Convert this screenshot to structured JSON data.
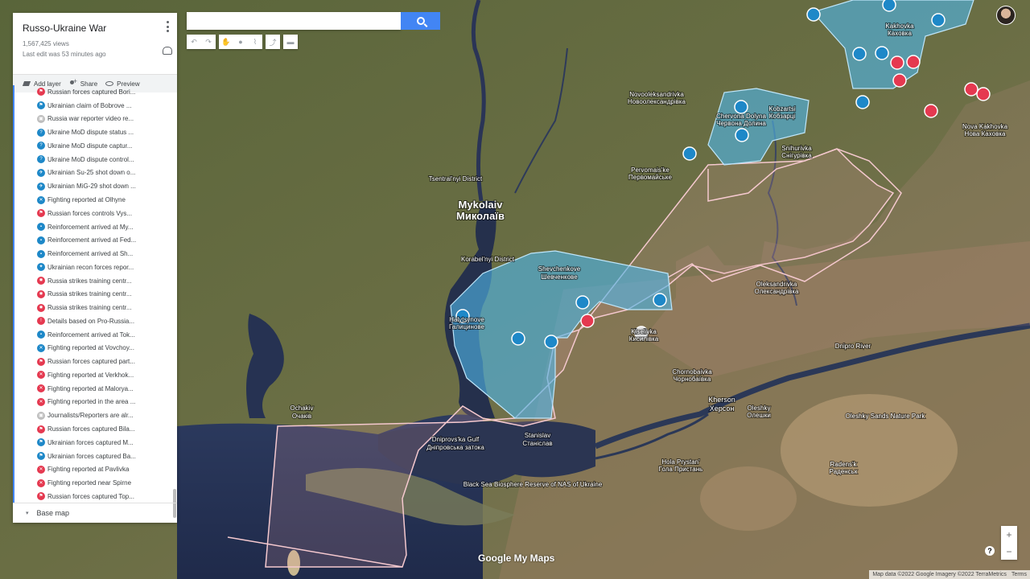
{
  "panel": {
    "title": "Russo-Ukraine War",
    "views": "1,567,425 views",
    "last_edit": "Last edit was 53 minutes ago",
    "actions": {
      "add_layer": "Add layer",
      "share": "Share",
      "preview": "Preview"
    },
    "base_map": "Base map",
    "items": [
      {
        "label": "Russian forces captured Bori...",
        "color": "#e53950",
        "icon": "flag"
      },
      {
        "label": "Ukrainian claim of Bobrove ...",
        "color": "#1e88c8",
        "icon": "flag"
      },
      {
        "label": "Russia war reporter video re...",
        "color": "#bdbdbd",
        "icon": "camera"
      },
      {
        "label": "Ukraine MoD dispute status ...",
        "color": "#1e88c8",
        "icon": "question"
      },
      {
        "label": "Ukraine MoD dispute captur...",
        "color": "#1e88c8",
        "icon": "question"
      },
      {
        "label": "Ukraine MoD dispute control...",
        "color": "#1e88c8",
        "icon": "question"
      },
      {
        "label": "Ukrainian Su-25 shot down o...",
        "color": "#1e88c8",
        "icon": "plane"
      },
      {
        "label": "Ukrainian MiG-29 shot down ...",
        "color": "#1e88c8",
        "icon": "plane"
      },
      {
        "label": "Fighting reported at Olhyne",
        "color": "#1e88c8",
        "icon": "swords"
      },
      {
        "label": "Russian forces controls Vys...",
        "color": "#e53950",
        "icon": "flag"
      },
      {
        "label": "Reinforcement arrived at My...",
        "color": "#1e88c8",
        "icon": "truck"
      },
      {
        "label": "Reinforcement arrived at Fed...",
        "color": "#1e88c8",
        "icon": "truck"
      },
      {
        "label": "Reinforcement arrived at Sh...",
        "color": "#1e88c8",
        "icon": "truck"
      },
      {
        "label": "Ukrainian recon forces repor...",
        "color": "#1e88c8",
        "icon": "walker"
      },
      {
        "label": "Russia strikes training centr...",
        "color": "#e53950",
        "icon": "burst"
      },
      {
        "label": "Russia strikes training centr...",
        "color": "#e53950",
        "icon": "burst"
      },
      {
        "label": "Russia strikes training centr...",
        "color": "#e53950",
        "icon": "burst"
      },
      {
        "label": "Details based on Pro-Russia...",
        "color": "#e53950",
        "icon": "warning"
      },
      {
        "label": "Reinforcement arrived at Tok...",
        "color": "#1e88c8",
        "icon": "truck"
      },
      {
        "label": "Fighting reported at Vovchoy...",
        "color": "#1e88c8",
        "icon": "swords"
      },
      {
        "label": "Russian forces captured part...",
        "color": "#e53950",
        "icon": "flag"
      },
      {
        "label": "Fighting reported at Verkhok...",
        "color": "#e53950",
        "icon": "swords"
      },
      {
        "label": "Fighting reported at Malorya...",
        "color": "#e53950",
        "icon": "swords"
      },
      {
        "label": "Fighting reported in the area ...",
        "color": "#e53950",
        "icon": "swords"
      },
      {
        "label": "Journalists/Reporters are alr...",
        "color": "#bdbdbd",
        "icon": "camera"
      },
      {
        "label": "Russian forces captured Bila...",
        "color": "#e53950",
        "icon": "flag"
      },
      {
        "label": "Ukrainian forces captured M...",
        "color": "#1e88c8",
        "icon": "flag"
      },
      {
        "label": "Ukrainian forces captured Ba...",
        "color": "#1e88c8",
        "icon": "flag"
      },
      {
        "label": "Fighting reported at Pavlivka",
        "color": "#e53950",
        "icon": "swords"
      },
      {
        "label": "Fighting reported near Spirne",
        "color": "#e53950",
        "icon": "swords"
      },
      {
        "label": "Russian forces captured Top...",
        "color": "#e53950",
        "icon": "flag"
      }
    ]
  },
  "search": {
    "value": "",
    "placeholder": ""
  },
  "toolbar": {
    "buttons": [
      {
        "name": "undo",
        "glyph": "↶"
      },
      {
        "name": "redo",
        "glyph": "↷"
      },
      {
        "name": "pan",
        "glyph": "✋"
      },
      {
        "name": "marker",
        "glyph": "●"
      },
      {
        "name": "draw-line",
        "glyph": "⌇"
      },
      {
        "name": "route",
        "glyph": "⤴"
      },
      {
        "name": "measure",
        "glyph": "▬"
      }
    ]
  },
  "colors": {
    "ukraine_zone": "#4fb4e6",
    "russia_zone": "#e8a0a8",
    "ukraine_marker": "#1e88c8",
    "russia_marker": "#e53950",
    "search_button": "#4285f4"
  },
  "map_labels": [
    {
      "text": "Mykolaiv",
      "tier": "big"
    },
    {
      "text": "Миколаїв",
      "tier": "big"
    },
    {
      "text": "Kherson",
      "tier": "mid"
    },
    {
      "text": "Херсон",
      "tier": "mid"
    },
    {
      "text": "Dnipro River",
      "tier": "small"
    },
    {
      "text": "Dniprovs'ka Gulf",
      "tier": "small"
    },
    {
      "text": "Дніпровська затока",
      "tier": "small"
    },
    {
      "text": "Black Sea Biosphere Reserve of NAS of Ukraine",
      "tier": "small"
    },
    {
      "text": "Oleshky Sands Nature Park",
      "tier": "small"
    },
    {
      "text": "Shevchenkove",
      "tier": "small"
    },
    {
      "text": "Шевченкове",
      "tier": "small"
    },
    {
      "text": "Stanislav",
      "tier": "small"
    },
    {
      "text": "Станіслав",
      "tier": "small"
    },
    {
      "text": "Ochakiv",
      "tier": "small"
    },
    {
      "text": "Очаків",
      "tier": "small"
    },
    {
      "text": "Nova Kakhovka",
      "tier": "small"
    },
    {
      "text": "Нова Каховка",
      "tier": "small"
    },
    {
      "text": "Snihurivka",
      "tier": "small"
    },
    {
      "text": "Снігурівка",
      "tier": "small"
    },
    {
      "text": "Oleksandrivka",
      "tier": "small"
    },
    {
      "text": "Олександрівка",
      "tier": "small"
    },
    {
      "text": "Halytsynove",
      "tier": "small"
    },
    {
      "text": "Галицинове",
      "tier": "small"
    },
    {
      "text": "Chornobaivka",
      "tier": "small"
    },
    {
      "text": "Чорнобаївка",
      "tier": "small"
    },
    {
      "text": "Oleshky",
      "tier": "small"
    },
    {
      "text": "Олешки",
      "tier": "small"
    },
    {
      "text": "Hola Prystan'",
      "tier": "small"
    },
    {
      "text": "Гола Пристань",
      "tier": "small"
    },
    {
      "text": "Pervomais'ke",
      "tier": "small"
    },
    {
      "text": "Первомайське",
      "tier": "small"
    },
    {
      "text": "Novooleksandrivka",
      "tier": "small"
    },
    {
      "text": "Новоолександрівка",
      "tier": "small"
    },
    {
      "text": "Kakhovka",
      "tier": "small"
    },
    {
      "text": "Каховка",
      "tier": "small"
    },
    {
      "text": "Tsentral'nyi District",
      "tier": "small"
    },
    {
      "text": "Korabel'nyi District",
      "tier": "small"
    },
    {
      "text": "Kobzartsi",
      "tier": "small"
    },
    {
      "text": "Кобзарці",
      "tier": "small"
    },
    {
      "text": "Chervona Dolyna",
      "tier": "small"
    },
    {
      "text": "Червона Долина",
      "tier": "small"
    },
    {
      "text": "Kiselivka",
      "tier": "small"
    },
    {
      "text": "Кисилівка",
      "tier": "small"
    },
    {
      "text": "Radens'k",
      "tier": "small"
    },
    {
      "text": "Раденськ",
      "tier": "small"
    }
  ],
  "attribution": {
    "text": "Map data ©2022 Google Imagery ©2022 TerraMetrics",
    "terms": "Terms"
  },
  "watermark": "Google My Maps",
  "zoom": {
    "in": "+",
    "out": "−"
  },
  "help": "?"
}
